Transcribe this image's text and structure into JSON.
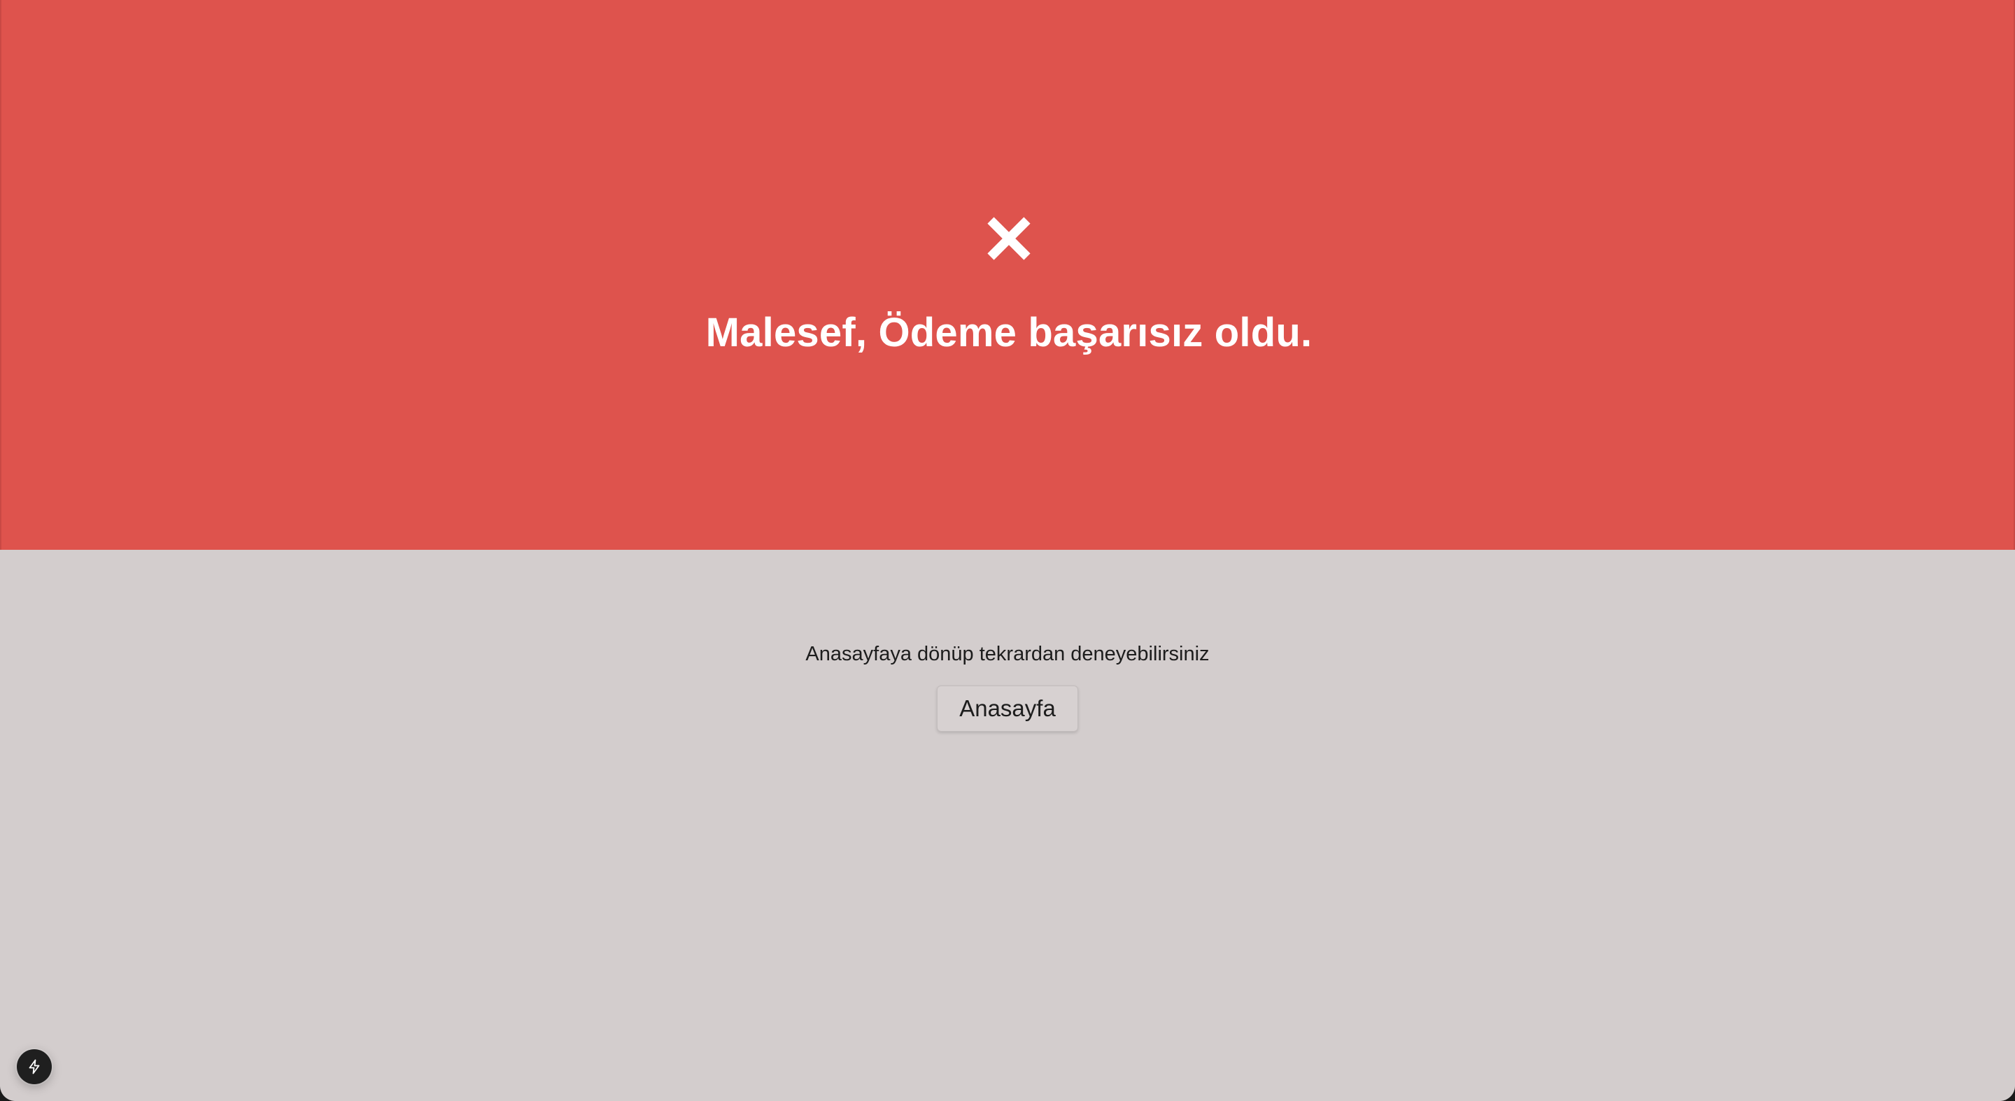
{
  "hero": {
    "icon": "close-icon",
    "title": "Malesef, Ödeme başarısız oldu.",
    "background_color": "#de534d"
  },
  "content": {
    "message": "Anasayfaya dönüp tekrardan deneyebilirsiniz",
    "home_button_label": "Anasayfa",
    "background_color": "#d3cdcd"
  },
  "dev_indicator": {
    "icon": "lightning-icon"
  }
}
